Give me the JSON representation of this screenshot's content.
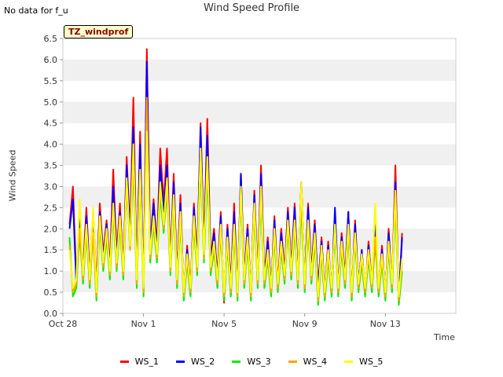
{
  "page": {
    "status_note": "No data for f_u",
    "site_badge": "TZ_windprof"
  },
  "chart_data": {
    "type": "line",
    "title": "Wind Speed Profile",
    "xlabel": "Time",
    "ylabel": "Wind Speed",
    "xlim": [
      "2023-10-28",
      "2023-11-16 12:00"
    ],
    "ylim": [
      0,
      6.5
    ],
    "x_tick_labels": [
      "Oct 28",
      "Nov 1",
      "Nov 5",
      "Nov 9",
      "Nov 13"
    ],
    "x_tick_dates": [
      "2023-10-28",
      "2023-11-01",
      "2023-11-05",
      "2023-11-09",
      "2023-11-13"
    ],
    "y_tick_labels": [
      "0.0",
      "0.5",
      "1.0",
      "1.5",
      "2.0",
      "2.5",
      "3.0",
      "3.5",
      "4.0",
      "4.5",
      "5.0",
      "5.5",
      "6.0",
      "6.5"
    ],
    "y_ticks": [
      0,
      0.5,
      1,
      1.5,
      2,
      2.5,
      3,
      3.5,
      4,
      4.5,
      5,
      5.5,
      6,
      6.5
    ],
    "grid": "horizontal bands",
    "legend_position": "bottom",
    "x": [
      "2023-10-28 08:00",
      "2023-10-28 12:00",
      "2023-10-28 16:00",
      "2023-10-28 20:00",
      "2023-10-29 00:00",
      "2023-10-29 04:00",
      "2023-10-29 08:00",
      "2023-10-29 12:00",
      "2023-10-29 16:00",
      "2023-10-29 20:00",
      "2023-10-30 00:00",
      "2023-10-30 04:00",
      "2023-10-30 08:00",
      "2023-10-30 12:00",
      "2023-10-30 16:00",
      "2023-10-30 20:00",
      "2023-10-31 00:00",
      "2023-10-31 04:00",
      "2023-10-31 08:00",
      "2023-10-31 12:00",
      "2023-10-31 16:00",
      "2023-10-31 20:00",
      "2023-11-01 00:00",
      "2023-11-01 04:00",
      "2023-11-01 08:00",
      "2023-11-01 12:00",
      "2023-11-01 16:00",
      "2023-11-01 20:00",
      "2023-11-02 00:00",
      "2023-11-02 04:00",
      "2023-11-02 08:00",
      "2023-11-02 12:00",
      "2023-11-02 16:00",
      "2023-11-02 20:00",
      "2023-11-03 00:00",
      "2023-11-03 04:00",
      "2023-11-03 08:00",
      "2023-11-03 12:00",
      "2023-11-03 16:00",
      "2023-11-03 20:00",
      "2023-11-04 00:00",
      "2023-11-04 04:00",
      "2023-11-04 08:00",
      "2023-11-04 12:00",
      "2023-11-04 16:00",
      "2023-11-04 20:00",
      "2023-11-05 00:00",
      "2023-11-05 04:00",
      "2023-11-05 08:00",
      "2023-11-05 12:00",
      "2023-11-05 16:00",
      "2023-11-05 20:00",
      "2023-11-06 00:00",
      "2023-11-06 04:00",
      "2023-11-06 08:00",
      "2023-11-06 12:00",
      "2023-11-06 16:00",
      "2023-11-06 20:00",
      "2023-11-07 00:00",
      "2023-11-07 04:00",
      "2023-11-07 08:00",
      "2023-11-07 12:00",
      "2023-11-07 16:00",
      "2023-11-07 20:00",
      "2023-11-08 00:00",
      "2023-11-08 04:00",
      "2023-11-08 08:00",
      "2023-11-08 12:00",
      "2023-11-08 16:00",
      "2023-11-08 20:00",
      "2023-11-09 00:00",
      "2023-11-09 04:00",
      "2023-11-09 08:00",
      "2023-11-09 12:00",
      "2023-11-09 16:00",
      "2023-11-09 20:00",
      "2023-11-10 00:00",
      "2023-11-10 04:00",
      "2023-11-10 08:00",
      "2023-11-10 12:00",
      "2023-11-10 16:00",
      "2023-11-10 20:00",
      "2023-11-11 00:00",
      "2023-11-11 04:00",
      "2023-11-11 08:00",
      "2023-11-11 12:00",
      "2023-11-11 16:00",
      "2023-11-11 20:00",
      "2023-11-12 00:00",
      "2023-11-12 04:00",
      "2023-11-12 08:00",
      "2023-11-12 12:00",
      "2023-11-12 16:00",
      "2023-11-12 20:00",
      "2023-11-13 00:00",
      "2023-11-13 04:00",
      "2023-11-13 08:00",
      "2023-11-13 12:00",
      "2023-11-13 16:00",
      "2023-11-13 20:00",
      "2023-11-14 00:00",
      "2023-11-14 04:00",
      "2023-11-14 08:00",
      "2023-11-14 12:00",
      "2023-11-14 16:00",
      "2023-11-14 20:00",
      "2023-11-15 00:00",
      "2023-11-15 04:00",
      "2023-11-15 08:00",
      "2023-11-15 12:00",
      "2023-11-15 16:00",
      "2023-11-15 20:00",
      "2023-11-16 00:00",
      "2023-11-16 04:00"
    ],
    "series": [
      {
        "name": "WS_1",
        "color": "#ff0000",
        "values": [
          2.1,
          3.0,
          0.8,
          2.3,
          1.0,
          2.5,
          0.9,
          2.4,
          0.7,
          2.6,
          1.4,
          2.2,
          1.1,
          3.4,
          1.4,
          2.6,
          1.1,
          3.7,
          1.9,
          5.1,
          0.9,
          4.3,
          0.5,
          6.25,
          1.6,
          2.7,
          1.6,
          3.9,
          2.6,
          3.9,
          1.2,
          3.3,
          0.9,
          2.8,
          0.4,
          1.6,
          0.6,
          2.6,
          1.3,
          4.5,
          1.6,
          4.6,
          1.3,
          2.0,
          0.9,
          2.4,
          0.25,
          2.1,
          0.7,
          2.6,
          0.5,
          3.3,
          0.9,
          2.1,
          0.4,
          2.9,
          0.9,
          3.5,
          0.9,
          1.8,
          0.6,
          2.3,
          0.7,
          2.0,
          1.0,
          2.5,
          1.1,
          2.6,
          0.8,
          3.1,
          0.7,
          2.6,
          1.0,
          2.2,
          0.6,
          1.8,
          0.5,
          1.7,
          0.5,
          2.3,
          0.6,
          1.9,
          0.9,
          2.4,
          0.4,
          2.2,
          0.7,
          1.5,
          0.5,
          1.7,
          0.7,
          2.2,
          0.5,
          1.6,
          0.4,
          2.0,
          0.6,
          3.5,
          0.3,
          1.9
        ]
      },
      {
        "name": "WS_2",
        "color": "#0000ff",
        "values": [
          2.0,
          2.7,
          0.7,
          2.2,
          0.9,
          2.3,
          0.8,
          2.2,
          0.6,
          2.4,
          1.3,
          2.1,
          1.0,
          3.0,
          1.3,
          2.4,
          1.0,
          3.5,
          1.8,
          4.4,
          0.8,
          4.0,
          0.5,
          5.95,
          1.5,
          2.6,
          1.5,
          3.5,
          2.4,
          3.5,
          1.1,
          3.1,
          0.8,
          2.6,
          0.4,
          1.5,
          0.6,
          2.5,
          1.2,
          4.4,
          1.5,
          4.2,
          1.2,
          1.9,
          0.8,
          2.3,
          0.3,
          2.0,
          0.6,
          2.4,
          0.5,
          3.3,
          0.8,
          2.0,
          0.4,
          2.8,
          0.8,
          3.3,
          0.8,
          1.7,
          0.6,
          2.2,
          0.6,
          1.9,
          0.9,
          2.4,
          1.0,
          2.5,
          0.8,
          3.1,
          0.7,
          2.5,
          0.9,
          2.1,
          0.6,
          1.7,
          0.5,
          1.6,
          0.5,
          2.5,
          0.6,
          1.8,
          0.8,
          2.4,
          0.4,
          2.1,
          0.7,
          1.5,
          0.5,
          1.6,
          0.6,
          2.1,
          0.5,
          1.5,
          0.4,
          1.9,
          0.6,
          3.1,
          0.3,
          1.8
        ]
      },
      {
        "name": "WS_3",
        "color": "#00ee00",
        "values": [
          1.8,
          0.4,
          0.6,
          1.9,
          0.7,
          1.9,
          0.6,
          1.9,
          0.3,
          2.1,
          1.0,
          1.8,
          0.8,
          2.4,
          1.0,
          2.1,
          0.8,
          3.0,
          1.5,
          3.5,
          0.6,
          3.2,
          0.4,
          4.9,
          1.2,
          2.1,
          1.2,
          2.8,
          1.9,
          2.9,
          0.9,
          2.6,
          0.6,
          2.2,
          0.3,
          1.2,
          0.4,
          2.1,
          0.9,
          3.6,
          1.2,
          3.3,
          0.9,
          1.5,
          0.6,
          1.9,
          0.3,
          1.6,
          0.4,
          1.9,
          0.3,
          2.8,
          0.6,
          1.6,
          0.3,
          2.4,
          0.6,
          2.7,
          0.6,
          1.3,
          0.4,
          1.8,
          0.5,
          1.5,
          0.7,
          2.0,
          0.8,
          2.0,
          0.6,
          2.6,
          0.5,
          2.0,
          0.7,
          1.7,
          0.2,
          1.4,
          0.3,
          1.3,
          0.4,
          1.9,
          0.4,
          1.5,
          0.6,
          1.9,
          0.3,
          1.7,
          0.5,
          1.2,
          0.4,
          1.3,
          0.5,
          1.7,
          0.4,
          1.2,
          0.3,
          1.5,
          0.5,
          2.6,
          0.2,
          1.0
        ]
      },
      {
        "name": "WS_4",
        "color": "#ffa500",
        "values": [
          1.6,
          0.5,
          0.7,
          2.0,
          0.8,
          2.0,
          0.7,
          1.9,
          0.4,
          2.2,
          1.1,
          1.9,
          0.9,
          2.5,
          1.1,
          2.2,
          0.9,
          3.1,
          1.5,
          3.7,
          0.7,
          3.3,
          0.5,
          5.1,
          1.3,
          2.2,
          1.3,
          3.0,
          2.0,
          3.0,
          1.0,
          2.7,
          0.7,
          2.3,
          0.4,
          1.3,
          0.5,
          2.2,
          1.0,
          3.8,
          1.3,
          3.6,
          1.0,
          1.6,
          0.7,
          2.0,
          0.4,
          1.7,
          0.5,
          2.0,
          0.4,
          2.9,
          0.7,
          1.7,
          0.4,
          2.5,
          0.7,
          2.9,
          0.7,
          1.4,
          0.5,
          1.9,
          0.6,
          1.6,
          0.8,
          2.1,
          0.9,
          2.1,
          0.7,
          2.8,
          0.6,
          2.1,
          0.8,
          1.8,
          0.3,
          1.5,
          0.4,
          1.4,
          0.5,
          2.0,
          0.5,
          1.6,
          0.7,
          2.0,
          0.4,
          1.8,
          0.6,
          1.3,
          0.5,
          1.4,
          0.6,
          1.8,
          0.5,
          1.3,
          0.4,
          1.6,
          0.6,
          2.8,
          0.3,
          1.2
        ]
      },
      {
        "name": "WS_5",
        "color": "#ffff00",
        "values": [
          1.5,
          0.6,
          0.8,
          2.7,
          0.9,
          2.1,
          0.8,
          2.5,
          0.5,
          2.3,
          1.2,
          2.0,
          1.0,
          2.6,
          1.2,
          2.3,
          1.0,
          3.2,
          1.6,
          4.0,
          0.8,
          3.4,
          0.6,
          4.3,
          1.4,
          2.3,
          1.4,
          3.1,
          2.1,
          3.2,
          1.1,
          2.8,
          0.8,
          2.4,
          0.5,
          1.4,
          0.6,
          2.3,
          1.1,
          3.9,
          1.4,
          3.7,
          1.1,
          1.7,
          0.8,
          2.1,
          0.5,
          1.8,
          0.6,
          2.1,
          0.5,
          3.0,
          0.8,
          1.8,
          0.5,
          2.6,
          0.8,
          3.0,
          0.8,
          1.5,
          0.6,
          2.0,
          0.7,
          1.7,
          0.9,
          2.2,
          1.0,
          2.2,
          0.8,
          3.1,
          0.7,
          2.2,
          0.9,
          1.9,
          0.4,
          1.6,
          0.5,
          1.5,
          0.6,
          2.1,
          0.6,
          1.7,
          0.8,
          2.1,
          0.5,
          1.9,
          0.7,
          1.4,
          0.6,
          1.5,
          0.7,
          2.6,
          0.6,
          1.4,
          0.5,
          1.7,
          0.7,
          2.9,
          0.4,
          1.3
        ]
      }
    ]
  }
}
